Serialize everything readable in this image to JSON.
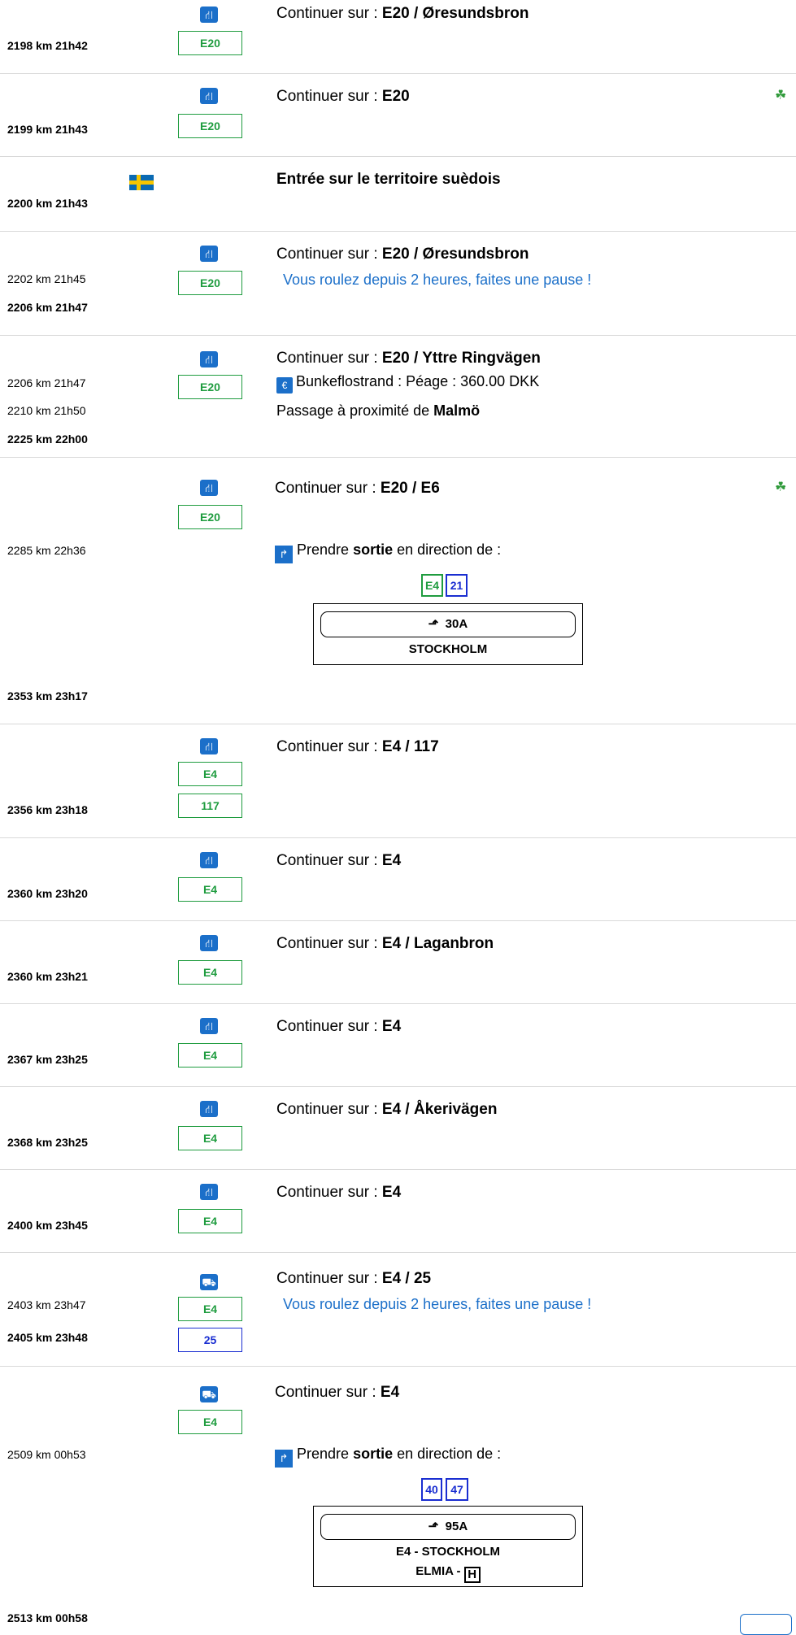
{
  "prefix": "Continuer sur : ",
  "exit_text": "Prendre",
  "exit_bold": "sortie",
  "exit_suffix": " en direction de :",
  "pause_note": "Vous roulez depuis 2 heures, faites une pause !",
  "steps": [
    {
      "road": "E20 / Øresundsbron",
      "km": "2198 km  21h42",
      "shield": "E20"
    },
    {
      "road": "E20",
      "km": "2199 km  21h43",
      "shield": "E20"
    },
    {
      "border": "Entrée sur le territoire suèdois",
      "km": "2200 km  21h43"
    },
    {
      "road": "E20 / Øresundsbron",
      "km1": "2202 km  21h45",
      "km2": "2206 km  21h47",
      "shield": "E20"
    },
    {
      "road": "E20 / Yttre Ringvägen",
      "km1": "2206 km  21h47",
      "km2": "2210 km  21h50",
      "km3": "2225 km  22h00",
      "shield": "E20",
      "toll": "Bunkeflostrand : Péage : 360.00 DKK",
      "near_prefix": "Passage à proximité de ",
      "near_city": "Malmö"
    },
    {
      "road": "E20 / E6",
      "shield": "E20",
      "km1": "2285 km  22h36",
      "km2": "2353 km  23h17",
      "mini": [
        "E4",
        "21"
      ],
      "exit_num": "30A",
      "dest": [
        "STOCKHOLM"
      ]
    },
    {
      "road": "E4 / 117",
      "km": "2356 km  23h18",
      "shields": [
        "E4",
        "117"
      ]
    },
    {
      "road": "E4",
      "km": "2360 km  23h20",
      "shield": "E4"
    },
    {
      "road": "E4 / Laganbron",
      "km": "2360 km  23h21",
      "shield": "E4"
    },
    {
      "road": "E4",
      "km": "2367 km  23h25",
      "shield": "E4"
    },
    {
      "road": "E4 / Åkerivägen",
      "km": "2368 km  23h25",
      "shield": "E4"
    },
    {
      "road": "E4",
      "km": "2400 km  23h45",
      "shield": "E4"
    },
    {
      "road": "E4 / 25",
      "km1": "2403 km  23h47",
      "km2": "2405 km  23h48",
      "shields": [
        "E4",
        "25"
      ]
    },
    {
      "road": "E4",
      "shield": "E4",
      "km1": "2509 km  00h53",
      "km2": "2513 km  00h58",
      "mini": [
        "40",
        "47"
      ],
      "exit_num": "95A",
      "dest": [
        "E4 - STOCKHOLM",
        "ELMIA - "
      ],
      "hospital": "H"
    }
  ]
}
